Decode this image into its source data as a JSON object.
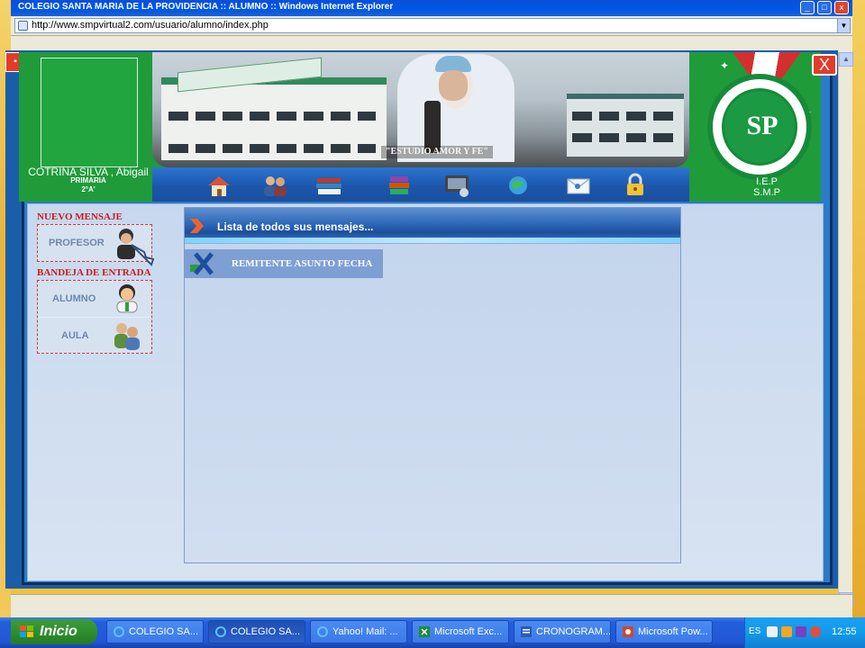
{
  "browser": {
    "title": "COLEGIO SANTA MARIA DE LA PROVIDENCIA :: ALUMNO :: Windows Internet Explorer",
    "address": "http://www.smpvirtual2.com/usuario/alumno/index.php"
  },
  "student": {
    "name": "COTRINA SILVA , Abigail",
    "level": "PRIMARIA",
    "section": "2°A'"
  },
  "banner": {
    "motto": "\"ESTUDIO AMOR Y FE\""
  },
  "nav_icons": [
    "home-icon",
    "users-icon",
    "books-icon",
    "library-icon",
    "computer-icon",
    "globe-icon",
    "mail-icon",
    "lock-icon"
  ],
  "school": {
    "monogram": "SP",
    "line1": "I.E.P",
    "line2": "S.M.P",
    "close": "X"
  },
  "sidebar": {
    "new_message_heading": "NUEVO MENSAJE",
    "new_message_items": [
      {
        "label": "PROFESOR",
        "icon": "teacher-icon"
      }
    ],
    "inbox_heading": "BANDEJA DE ENTRADA",
    "inbox_items": [
      {
        "label": "ALUMNO",
        "icon": "student-icon"
      },
      {
        "label": "AULA",
        "icon": "classroom-icon"
      }
    ]
  },
  "messages": {
    "title": "Lista de todos sus mensajes...",
    "columns": "REMITENTE ASUNTO FECHA"
  },
  "taskbar": {
    "start": "Inicio",
    "buttons": [
      {
        "label": "COLEGIO SA...",
        "active": false
      },
      {
        "label": "COLEGIO SA...",
        "active": true
      },
      {
        "label": "Yahoo! Mail: ...",
        "active": false
      },
      {
        "label": "Microsoft Exc...",
        "active": false
      },
      {
        "label": "CRONOGRAM...",
        "active": false
      },
      {
        "label": "Microsoft Pow...",
        "active": false
      }
    ],
    "lang": "ES",
    "clock": "12:55"
  },
  "colors": {
    "header_green": "#1f9b3a",
    "nav_blue": "#1c56ad",
    "heading_red": "#cc1b1b",
    "panel_blue": "#c7d8ee"
  }
}
